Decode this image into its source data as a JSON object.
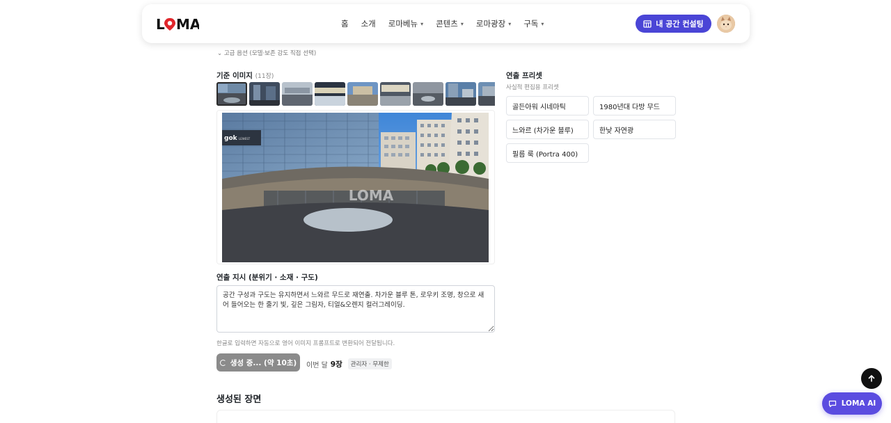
{
  "header": {
    "logo": "LOMA",
    "nav": [
      {
        "label": "홈",
        "dropdown": false
      },
      {
        "label": "소개",
        "dropdown": false
      },
      {
        "label": "로마베뉴",
        "dropdown": true
      },
      {
        "label": "콘텐츠",
        "dropdown": true
      },
      {
        "label": "로마광장",
        "dropdown": true
      },
      {
        "label": "구독",
        "dropdown": true
      }
    ],
    "consult_button": "내 공간 컨설팅"
  },
  "advanced_toggle": "⌄ 고급 옵션 (모델·보존 강도 직접 선택)",
  "reference": {
    "title": "기준 이미지",
    "count": "(11장)",
    "watermark": "LOMA"
  },
  "instruction": {
    "title": "연출 지시 (분위기 · 소재 · 구도)",
    "value": "공간 구성과 구도는 유지하면서 느와르 무드로 재연출. 차가운 블루 톤, 로우키 조명, 창으로 새어 들어오는 한 줄기 빛, 깊은 그림자, 티얼&오렌지 컬러그레이딩.",
    "hint": "한글로 입력하면 자동으로 영어 이미지 프롬프트로 변환되어 전달됩니다."
  },
  "generate": {
    "button": "생성 중... (약 10초)",
    "usage_prefix": "이번 달",
    "usage_count": "9장",
    "badge": "관리자 · 무제한"
  },
  "generated": {
    "title": "생성된 장면"
  },
  "presets": {
    "title": "연출 프리셋",
    "subtitle": "사실적 편집용 프리셋",
    "items": [
      "골든아워 시네마틱",
      "1980년대 다방 무드",
      "느와르 (차가운 블루)",
      "한낮 자연광",
      "필름 룩 (Portra 400)"
    ]
  },
  "floating": {
    "ai_button": "LOMA AI"
  },
  "colors": {
    "accent": "#4a45d6",
    "ai": "#5b4ce0",
    "disabled_button": "#8b8b8b"
  }
}
